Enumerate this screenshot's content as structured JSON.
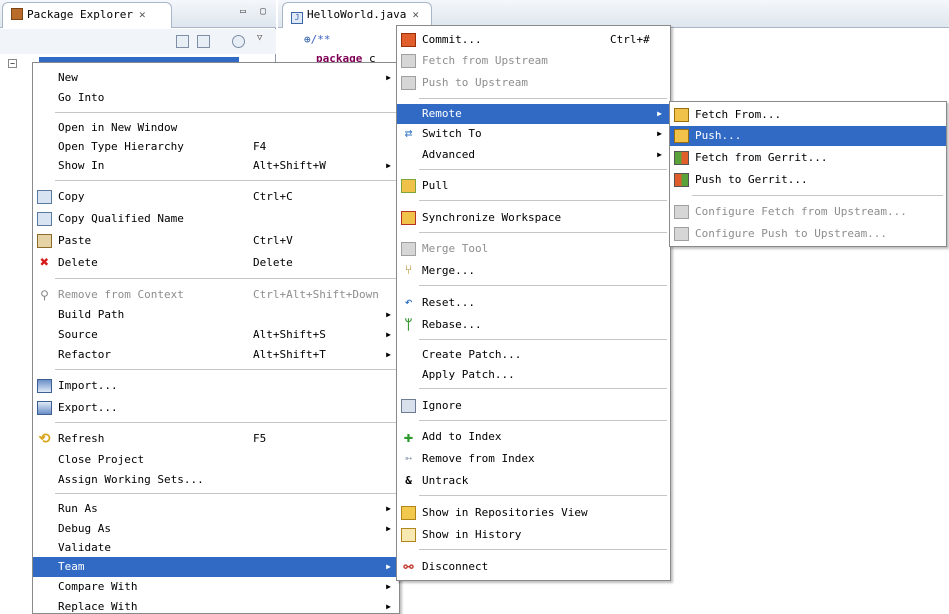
{
  "package_explorer": {
    "title": "Package Explorer"
  },
  "editor": {
    "tab_title": "HelloWorld.java",
    "code_line1": "/**",
    "code_line2_keyword": "package",
    "code_line2_rest": "c"
  },
  "context_menu": {
    "items": [
      {
        "label": "New"
      },
      {
        "label": "Go Into"
      },
      {
        "label": "Open in New Window"
      },
      {
        "label": "Open Type Hierarchy",
        "accel": "F4"
      },
      {
        "label": "Show In",
        "accel": "Alt+Shift+W"
      },
      {
        "label": "Copy",
        "accel": "Ctrl+C"
      },
      {
        "label": "Copy Qualified Name"
      },
      {
        "label": "Paste",
        "accel": "Ctrl+V"
      },
      {
        "label": "Delete",
        "accel": "Delete"
      },
      {
        "label": "Remove from Context",
        "accel": "Ctrl+Alt+Shift+Down"
      },
      {
        "label": "Build Path"
      },
      {
        "label": "Source",
        "accel": "Alt+Shift+S"
      },
      {
        "label": "Refactor",
        "accel": "Alt+Shift+T"
      },
      {
        "label": "Import..."
      },
      {
        "label": "Export..."
      },
      {
        "label": "Refresh",
        "accel": "F5"
      },
      {
        "label": "Close Project"
      },
      {
        "label": "Assign Working Sets..."
      },
      {
        "label": "Run As"
      },
      {
        "label": "Debug As"
      },
      {
        "label": "Validate"
      },
      {
        "label": "Team"
      },
      {
        "label": "Compare With"
      },
      {
        "label": "Replace With"
      }
    ]
  },
  "team_menu": {
    "items": [
      {
        "label": "Commit...",
        "accel": "Ctrl+#"
      },
      {
        "label": "Fetch from Upstream"
      },
      {
        "label": "Push to Upstream"
      },
      {
        "label": "Remote"
      },
      {
        "label": "Switch To"
      },
      {
        "label": "Advanced"
      },
      {
        "label": "Pull"
      },
      {
        "label": "Synchronize Workspace"
      },
      {
        "label": "Merge Tool"
      },
      {
        "label": "Merge..."
      },
      {
        "label": "Reset..."
      },
      {
        "label": "Rebase..."
      },
      {
        "label": "Create Patch..."
      },
      {
        "label": "Apply Patch..."
      },
      {
        "label": "Ignore"
      },
      {
        "label": "Add to Index"
      },
      {
        "label": "Remove from Index"
      },
      {
        "label": "Untrack"
      },
      {
        "label": "Show in Repositories View"
      },
      {
        "label": "Show in History"
      },
      {
        "label": "Disconnect"
      }
    ]
  },
  "remote_menu": {
    "items": [
      {
        "label": "Fetch From..."
      },
      {
        "label": "Push..."
      },
      {
        "label": "Fetch from Gerrit..."
      },
      {
        "label": "Push to Gerrit..."
      },
      {
        "label": "Configure Fetch from Upstream..."
      },
      {
        "label": "Configure Push to Upstream..."
      }
    ]
  }
}
